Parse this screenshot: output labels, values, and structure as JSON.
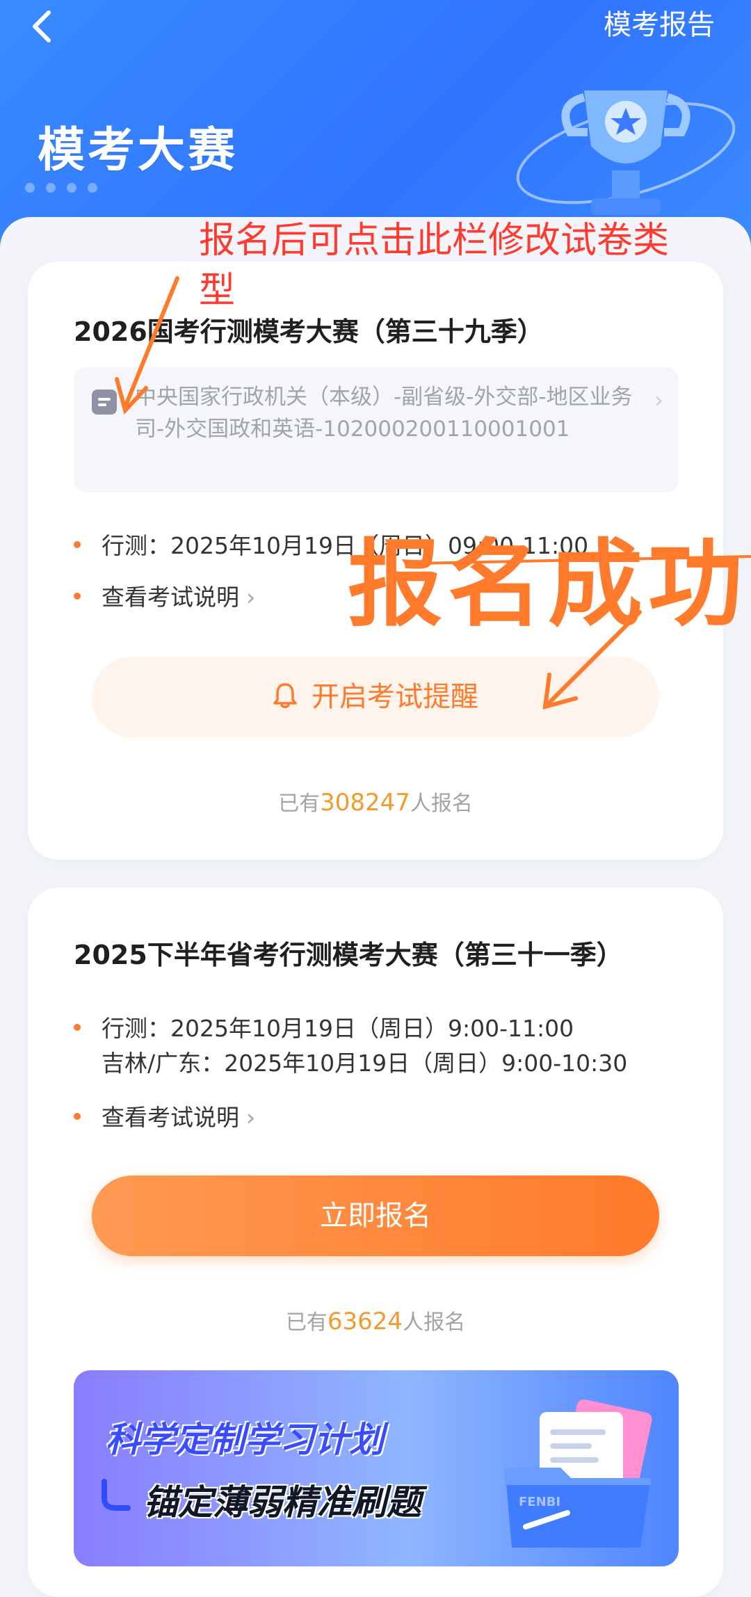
{
  "header": {
    "back_icon": "chevron-left-icon",
    "report_link": "模考报告",
    "title": "模考大赛"
  },
  "annotations": {
    "hint": "报名后可点击此栏修改试卷类型",
    "success": "报名成功"
  },
  "contest1": {
    "title": "2026国考行测模考大赛（第三十九季）",
    "paper_type": "中央国家行政机关（本级）-副省级-外交部-地区业务司-外交国政和英语-102000200110001001",
    "schedule": "行测：2025年10月19日（周日）09:00-11:00",
    "exam_info_link": "查看考试说明",
    "remind_button": "开启考试提醒",
    "count_prefix": "已有",
    "count": "308247",
    "count_suffix": "人报名"
  },
  "contest2": {
    "title": "2025下半年省考行测模考大赛（第三十一季）",
    "schedule_line1": "行测：2025年10月19日（周日）9:00-11:00",
    "schedule_line2": "吉林/广东：2025年10月19日（周日）9:00-10:30",
    "exam_info_link": "查看考试说明",
    "signup_button": "立即报名",
    "count_prefix": "已有",
    "count": "63624",
    "count_suffix": "人报名"
  },
  "banner": {
    "line1": "科学定制学习计划",
    "line2": "锚定薄弱精准刷题",
    "logo": "FENBI"
  },
  "colors": {
    "header_blue": "#2f74ff",
    "accent_orange": "#ff7a2a",
    "annotation_red": "#ff3b2f",
    "count_orange": "#f29a2e"
  }
}
